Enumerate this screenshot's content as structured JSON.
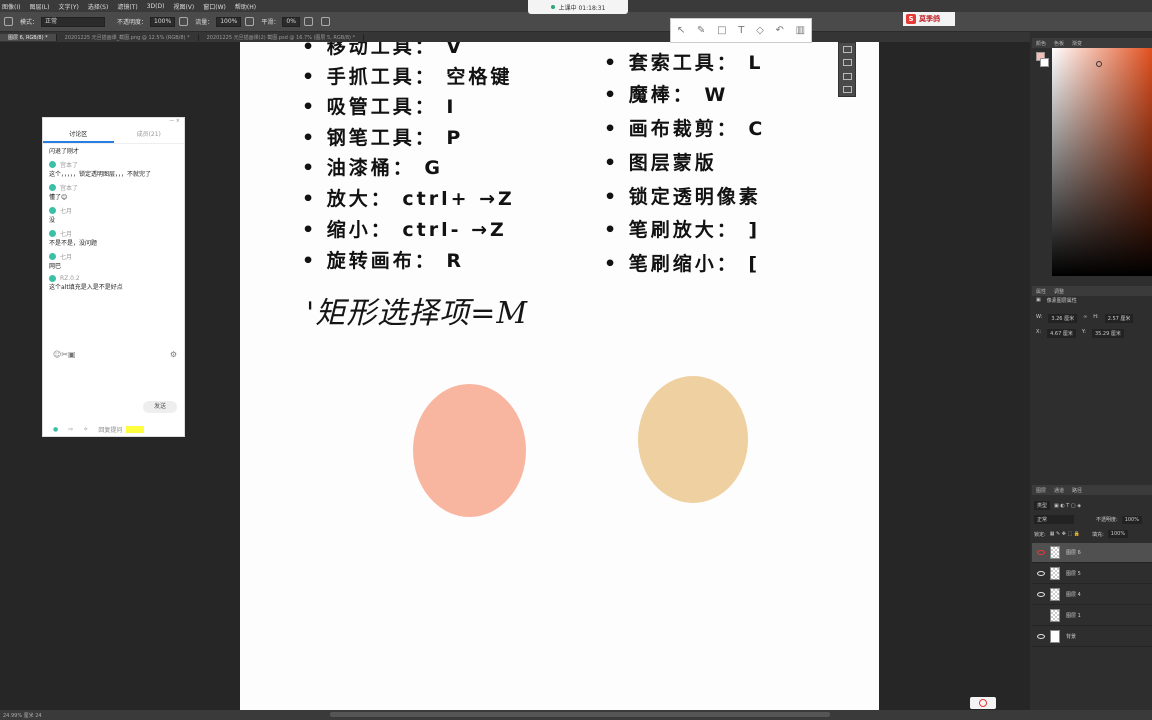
{
  "menubar": {
    "items": [
      "图像(I)",
      "图层(L)",
      "文字(Y)",
      "选择(S)",
      "滤镜(T)",
      "3D(D)",
      "视图(V)",
      "窗口(W)",
      "帮助(H)"
    ]
  },
  "recording": {
    "label": "上课中 01:18:31"
  },
  "brand": {
    "label": "莫季鸽"
  },
  "options": {
    "mode_label": "模式：",
    "mode_value": "正常",
    "opacity_label": "不透明度：",
    "opacity_value": "100%",
    "flow_label": "流量：",
    "flow_value": "100%",
    "smooth_label": "平滑：",
    "smooth_value": "0%"
  },
  "tabs": [
    "图层 6, RGB/8) *",
    "20201225 元旦插画课_截图.png @ 12.5% (RGB/8) *",
    "20201225 元旦插画课(2) 截图.psd @ 16.7% (图层 5, RGB/8) *"
  ],
  "canvas": {
    "left_list": [
      "• 移动工具： V",
      "• 手抓工具： 空格键",
      "• 吸管工具： I",
      "• 钢笔工具： P",
      "• 油漆桶： G",
      "• 放大： ctrl+ →Z",
      "• 缩小： ctrl- →Z",
      "• 旋转画布： R"
    ],
    "right_list": [
      "• 套索工具： L",
      "• 魔棒： W",
      "• 画布裁剪： C",
      "• 图层蒙版",
      "• 锁定透明像素",
      "• 笔刷放大： ]",
      "• 笔刷缩小： ["
    ],
    "handwriting": "'矩形选择项=M",
    "swatch_colors": [
      "#f8b6a0",
      "#efd0a0"
    ]
  },
  "chat": {
    "tab_discussion": "讨论区",
    "tab_members": "成员(21)",
    "messages": [
      {
        "name": "",
        "text": "闪退了刚才"
      },
      {
        "name": "宫本了",
        "text": "这个，，，，，锁定透明图层，，，不就完了"
      },
      {
        "name": "宫本了",
        "text": "懂了😊"
      },
      {
        "name": "七月",
        "text": "没"
      },
      {
        "name": "七月",
        "text": "不是不是，没问题"
      },
      {
        "name": "七月",
        "text": "网巴"
      },
      {
        "name": "RZ.0.2",
        "text": "这个alt填充是入是不是好点"
      }
    ],
    "send_label": "发送",
    "footer_label": "回复提问"
  },
  "panels": {
    "color_tabs": [
      "颜色",
      "色板",
      "渐变"
    ],
    "props_tabs": [
      "属性",
      "调整"
    ],
    "props_title": "像素图层属性",
    "w_label": "W:",
    "w_value": "3.26 厘米",
    "h_label": "H:",
    "h_value": "2.57 厘米",
    "x_label": "X:",
    "x_value": "4.67 厘米",
    "y_label": "Y:",
    "y_value": "35.29 厘米",
    "layer_tabs": [
      "图层",
      "通道",
      "路径"
    ],
    "kind_label": "类型",
    "blend_value": "正常",
    "opacity_label": "不透明度:",
    "opacity_value": "100%",
    "lock_label": "锁定:",
    "fill_label": "填充:",
    "fill_value": "100%",
    "layers": [
      "图层 6",
      "图层 5",
      "图层 4",
      "图层 1",
      "背景"
    ]
  },
  "status": {
    "zoom": "24.99% 厘米  24"
  }
}
